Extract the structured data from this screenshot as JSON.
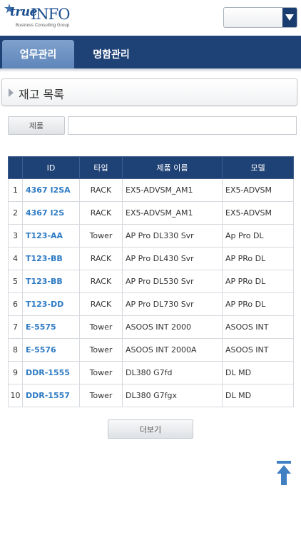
{
  "header": {
    "logo_true": "true",
    "logo_info": "INFO",
    "logo_sub": "Business Consulting Group",
    "select_value": ""
  },
  "tabs": [
    {
      "label": "업무관리",
      "active": true
    },
    {
      "label": "명함관리",
      "active": false
    }
  ],
  "section": {
    "title": "재고 목록"
  },
  "search": {
    "button_label": "제품",
    "input_value": "",
    "input_placeholder": ""
  },
  "table": {
    "columns": [
      "",
      "ID",
      "타입",
      "제품 이름",
      "모델"
    ],
    "rows": [
      {
        "num": "1",
        "id": "4367 I2SA",
        "type": "RACK",
        "name": "EX5-ADVSM_AM1",
        "model": "EX5-ADVSM"
      },
      {
        "num": "2",
        "id": "4367 I2S",
        "type": "RACK",
        "name": "EX5-ADVSM_AM1",
        "model": "EX5-ADVSM"
      },
      {
        "num": "3",
        "id": "T123-AA",
        "type": "Tower",
        "name": "AP Pro DL330 Svr",
        "model": "Ap Pro DL"
      },
      {
        "num": "4",
        "id": "T123-BB",
        "type": "RACK",
        "name": "AP Pro DL430 Svr",
        "model": "AP PRo DL"
      },
      {
        "num": "5",
        "id": "T123-BB",
        "type": "RACK",
        "name": "AP Pro DL530 Svr",
        "model": "AP PRo DL"
      },
      {
        "num": "6",
        "id": "T123-DD",
        "type": "RACK",
        "name": "AP Pro DL730 Svr",
        "model": "AP PRo DL"
      },
      {
        "num": "7",
        "id": "E-5575",
        "type": "Tower",
        "name": "ASOOS INT 2000",
        "model": "ASOOS INT"
      },
      {
        "num": "8",
        "id": "E-5576",
        "type": "Tower",
        "name": "ASOOS INT 2000A",
        "model": "ASOOS INT"
      },
      {
        "num": "9",
        "id": "DDR-1555",
        "type": "Tower",
        "name": "DL380 G7fd",
        "model": "DL MD"
      },
      {
        "num": "10",
        "id": "DDR-1557",
        "type": "Tower",
        "name": "DL380 G7fgx",
        "model": "DL MD"
      }
    ]
  },
  "more_button": {
    "label": "더보기"
  },
  "colors": {
    "navy": "#1f4276",
    "link": "#2f7bc4",
    "tab_active": "#6f94c4"
  },
  "icons": {
    "dropdown": "chevron-down-icon",
    "section": "triangle-right-icon",
    "scroll_top": "arrow-up-to-top-icon",
    "logo_star": "star-icon"
  }
}
